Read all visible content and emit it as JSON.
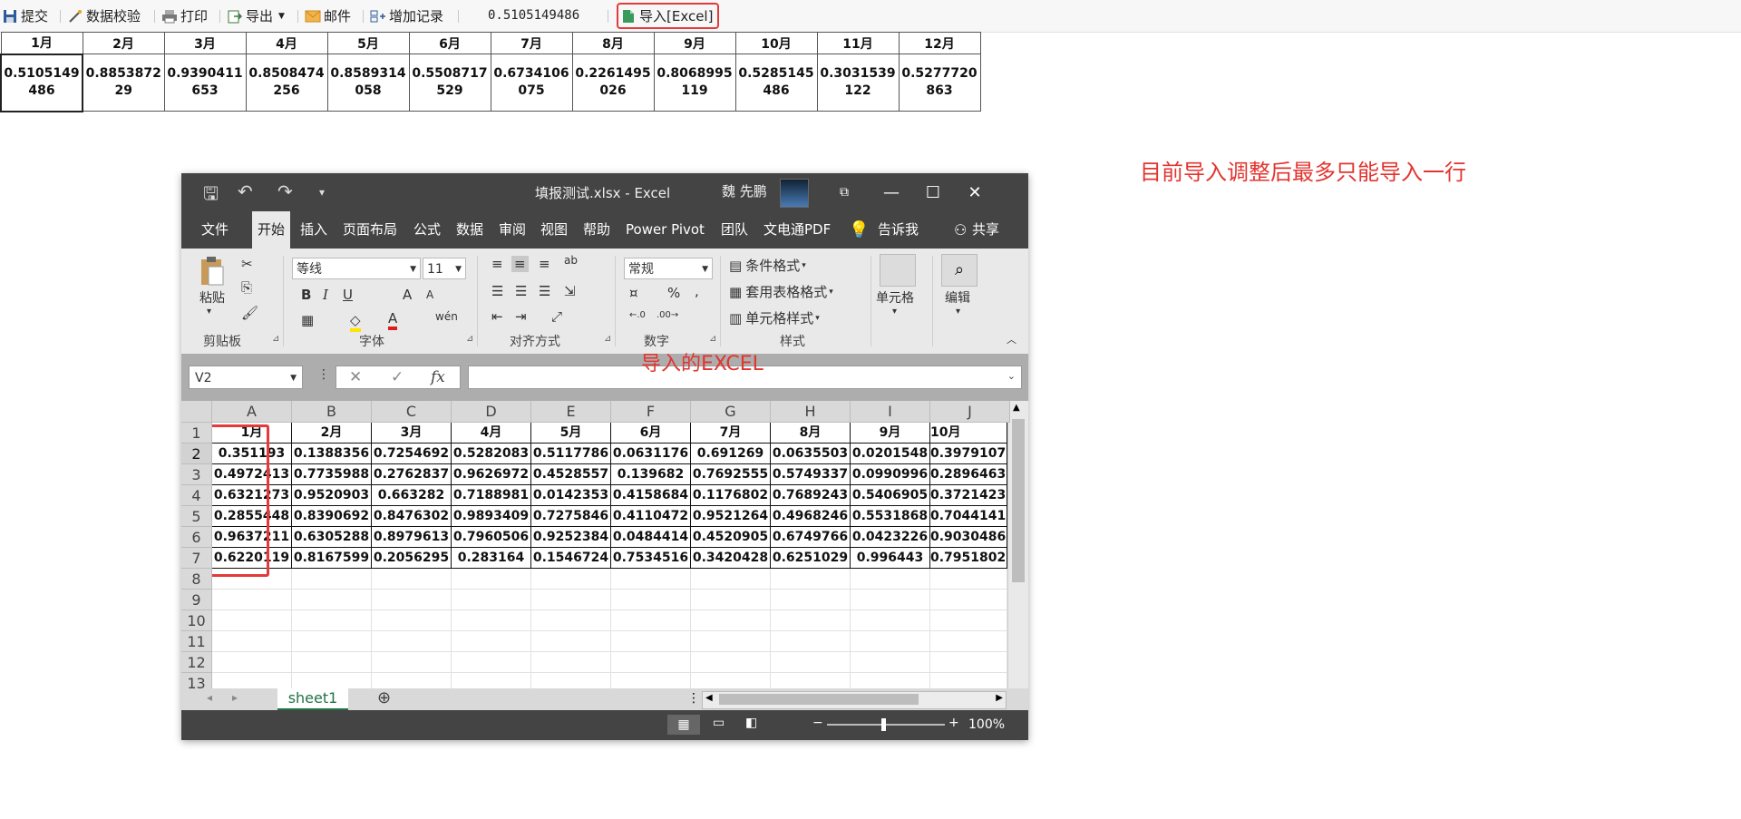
{
  "toolbar": {
    "items": [
      {
        "label": "提交",
        "icon": "save-icon"
      },
      {
        "label": "数据校验",
        "icon": "check-wand-icon"
      },
      {
        "label": "打印",
        "icon": "printer-icon"
      },
      {
        "label": "导出",
        "icon": "export-icon"
      },
      {
        "label": "邮件",
        "icon": "mail-icon"
      },
      {
        "label": "增加记录",
        "icon": "add-record-icon"
      }
    ],
    "cell_value": "0.5105149486",
    "import_label": "导入[Excel]"
  },
  "report": {
    "headers": [
      "1月",
      "2月",
      "3月",
      "4月",
      "5月",
      "6月",
      "7月",
      "8月",
      "9月",
      "10月",
      "11月",
      "12月"
    ],
    "values": [
      "0.5105149486",
      "0.885387229",
      "0.9390411653",
      "0.8508474256",
      "0.8589314058",
      "0.5508717529",
      "0.6734106075",
      "0.2261495026",
      "0.8068995119",
      "0.5285145486",
      "0.3031539122",
      "0.5277720863"
    ]
  },
  "annotation": "目前导入调整后最多只能导入一行",
  "excel": {
    "doc_title": "填报测试.xlsx  -  Excel",
    "user": "魏 先鹏",
    "tabs": [
      "文件",
      "开始",
      "插入",
      "页面布局",
      "公式",
      "数据",
      "审阅",
      "视图",
      "帮助",
      "Power Pivot",
      "团队",
      "文电通PDF",
      "告诉我",
      "共享"
    ],
    "active_tab": "开始",
    "ribbon": {
      "paste": "粘贴",
      "font_name": "等线",
      "font_size": "11",
      "number_format": "常规",
      "conditional_format": "条件格式",
      "table_format": "套用表格格式",
      "cell_style": "单元格样式",
      "cells": "单元格",
      "editing": "编辑",
      "groups": [
        "剪贴板",
        "字体",
        "对齐方式",
        "数字",
        "样式"
      ]
    },
    "name_box": "V2",
    "caption": "导入的EXCEL",
    "columns": [
      "A",
      "B",
      "C",
      "D",
      "E",
      "F",
      "G",
      "H",
      "I",
      "J"
    ],
    "row_numbers": [
      "1",
      "2",
      "3",
      "4",
      "5",
      "6",
      "7",
      "8",
      "9",
      "10",
      "11",
      "12",
      "13"
    ],
    "header_row": [
      "1月",
      "2月",
      "3月",
      "4月",
      "5月",
      "6月",
      "7月",
      "8月",
      "9月",
      "10月"
    ],
    "rows": [
      [
        "0.351193",
        "0.1388356",
        "0.7254692",
        "0.5282083",
        "0.5117786",
        "0.0631176",
        "0.691269",
        "0.0635503",
        "0.0201548",
        "0.3979107"
      ],
      [
        "0.4972413",
        "0.7735988",
        "0.2762837",
        "0.9626972",
        "0.4528557",
        "0.139682",
        "0.7692555",
        "0.5749337",
        "0.0990996",
        "0.2896463"
      ],
      [
        "0.6321273",
        "0.9520903",
        "0.663282",
        "0.7188981",
        "0.0142353",
        "0.4158684",
        "0.1176802",
        "0.7689243",
        "0.5406905",
        "0.3721423"
      ],
      [
        "0.2855448",
        "0.8390692",
        "0.8476302",
        "0.9893409",
        "0.7275846",
        "0.4110472",
        "0.9521264",
        "0.4968246",
        "0.5531868",
        "0.7044141"
      ],
      [
        "0.9637211",
        "0.6305288",
        "0.8979613",
        "0.7960506",
        "0.9252384",
        "0.0484414",
        "0.4520905",
        "0.6749766",
        "0.0423226",
        "0.9030486"
      ],
      [
        "0.6220119",
        "0.8167599",
        "0.2056295",
        "0.283164",
        "0.1546724",
        "0.7534516",
        "0.3420428",
        "0.6251029",
        "0.996443",
        "0.7951802"
      ]
    ],
    "sheet_tab": "sheet1",
    "zoom": "100%"
  },
  "colors": {
    "accent_red": "#e3342f",
    "excel_green": "#217346",
    "title_bar": "#444444"
  }
}
